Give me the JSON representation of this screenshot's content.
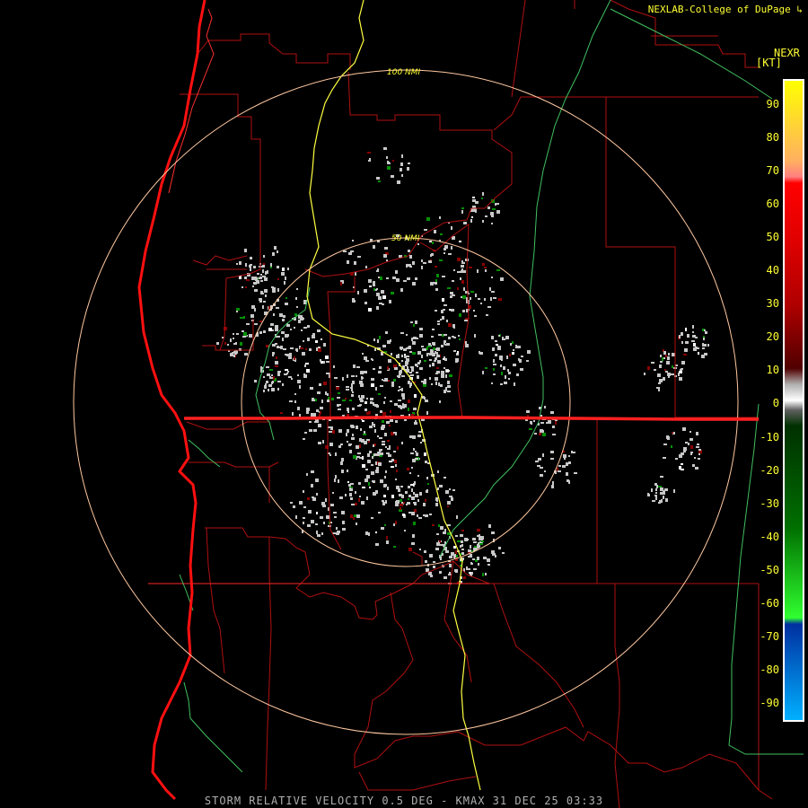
{
  "credit": "NEXLAB-College of DuPage",
  "product_code": "NEXR",
  "unit": "[KT]",
  "legend": {
    "ticks": [
      "90",
      "80",
      "70",
      "60",
      "50",
      "40",
      "30",
      "20",
      "10",
      "0",
      "-10",
      "-20",
      "-30",
      "-40",
      "-50",
      "-60",
      "-70",
      "-80",
      "-90"
    ],
    "stops": [
      {
        "value": 100,
        "color": "#ffff00"
      },
      {
        "value": 75,
        "color": "#ffb060"
      },
      {
        "value": 70,
        "color": "#ff8080"
      },
      {
        "value": 68,
        "color": "#ff0000"
      },
      {
        "value": 50,
        "color": "#e00000"
      },
      {
        "value": 30,
        "color": "#b00000"
      },
      {
        "value": 10,
        "color": "#500000"
      },
      {
        "value": 5,
        "color": "#b0b0b0"
      },
      {
        "value": 0,
        "color": "#ffffff"
      },
      {
        "value": -3,
        "color": "#606060"
      },
      {
        "value": -8,
        "color": "#003000"
      },
      {
        "value": -40,
        "color": "#007000"
      },
      {
        "value": -68,
        "color": "#30ff30"
      },
      {
        "value": -70,
        "color": "#0030a0"
      },
      {
        "value": -100,
        "color": "#00b0ff"
      }
    ]
  },
  "rings": [
    {
      "label": "50 NMI"
    },
    {
      "label": "100 NMI"
    }
  ],
  "footer": "STORM RELATIVE VELOCITY 0.5 DEG - KMAX 31 DEC 25 03:33",
  "colors": {
    "background": "#000000",
    "text": "#ffff33",
    "county_lines": "#b01010",
    "state_line": "#cc2020",
    "coastline": "#ff1010",
    "river": "#40c060",
    "highway": "#ffff40",
    "range_rings": "#ffc8a0",
    "beam_artifact": "#ff2020"
  },
  "icons": {
    "credit_logo": "corner-logo-icon"
  }
}
